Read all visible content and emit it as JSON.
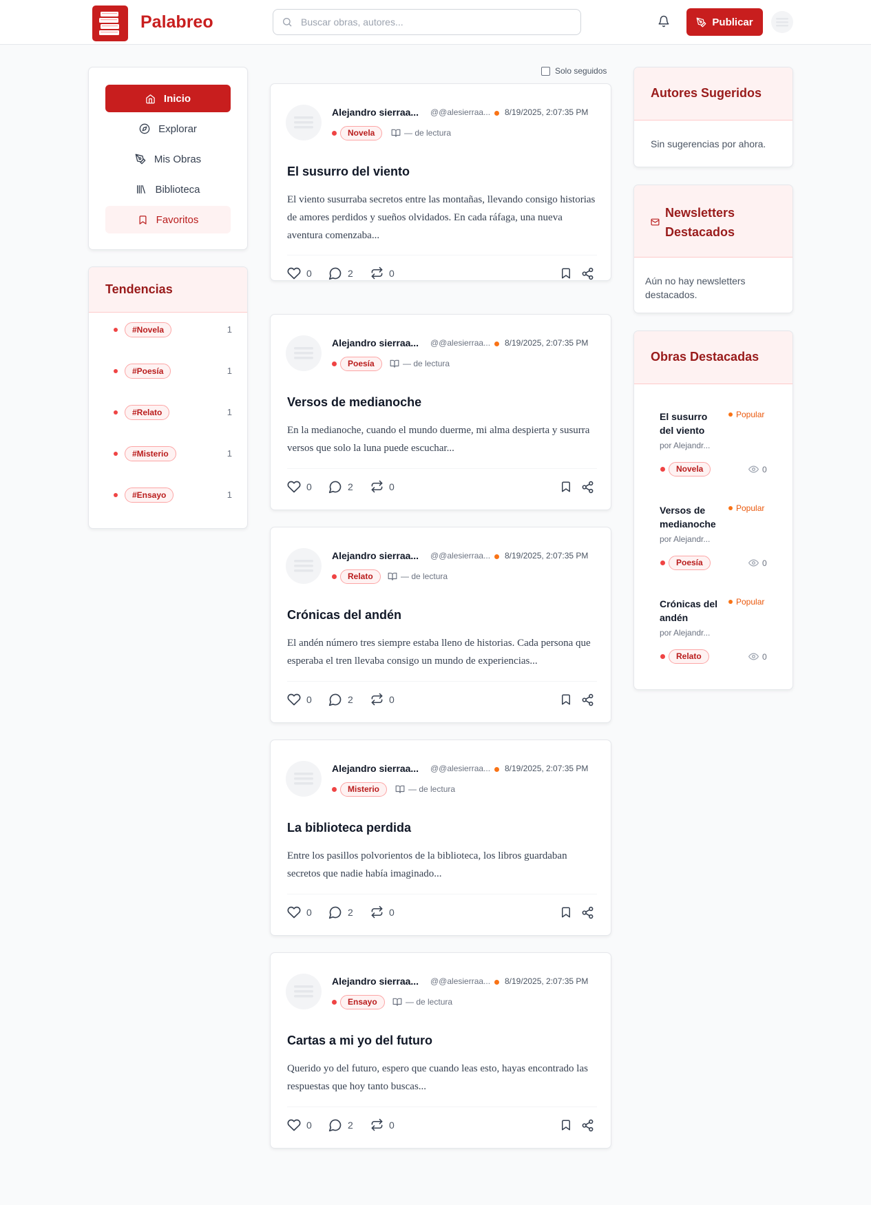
{
  "brand": {
    "name": "Palabreo",
    "color": "#c81e1e"
  },
  "header": {
    "search_placeholder": "Buscar obras, autores...",
    "publish_label": "Publicar"
  },
  "nav": {
    "items": [
      {
        "label": "Inicio",
        "icon": "home-icon",
        "state": "active"
      },
      {
        "label": "Explorar",
        "icon": "compass-icon"
      },
      {
        "label": "Mis Obras",
        "icon": "pen-icon"
      },
      {
        "label": "Biblioteca",
        "icon": "library-icon"
      },
      {
        "label": "Favoritos",
        "icon": "bookmark-icon",
        "state": "highlighted"
      }
    ]
  },
  "trends": {
    "title": "Tendencias",
    "items": [
      {
        "tag": "#Novela",
        "count": "1"
      },
      {
        "tag": "#Poesía",
        "count": "1"
      },
      {
        "tag": "#Relato",
        "count": "1"
      },
      {
        "tag": "#Misterio",
        "count": "1"
      },
      {
        "tag": "#Ensayo",
        "count": "1"
      }
    ]
  },
  "feed": {
    "filter_label": "Solo seguidos",
    "posts": [
      {
        "author": "Alejandro sierraa...",
        "handle": "@@alesierraa...",
        "date": "8/19/2025, 2:07:35 PM",
        "genre": "Novela",
        "reading": "— de lectura",
        "title": "El susurro del viento",
        "excerpt": "El viento susurraba secretos entre las montañas, llevando consigo historias de amores perdidos y sueños olvidados. En cada ráfaga, una nueva aventura comenzaba...",
        "likes": "0",
        "comments": "2",
        "reposts": "0"
      },
      {
        "author": "Alejandro sierraa...",
        "handle": "@@alesierraa...",
        "date": "8/19/2025, 2:07:35 PM",
        "genre": "Poesía",
        "reading": "— de lectura",
        "title": "Versos de medianoche",
        "excerpt": "En la medianoche, cuando el mundo duerme, mi alma despierta y susurra versos que solo la luna puede escuchar...",
        "likes": "0",
        "comments": "2",
        "reposts": "0"
      },
      {
        "author": "Alejandro sierraa...",
        "handle": "@@alesierraa...",
        "date": "8/19/2025, 2:07:35 PM",
        "genre": "Relato",
        "reading": "— de lectura",
        "title": "Crónicas del andén",
        "excerpt": "El andén número tres siempre estaba lleno de historias. Cada persona que esperaba el tren llevaba consigo un mundo de experiencias...",
        "likes": "0",
        "comments": "2",
        "reposts": "0"
      },
      {
        "author": "Alejandro sierraa...",
        "handle": "@@alesierraa...",
        "date": "8/19/2025, 2:07:35 PM",
        "genre": "Misterio",
        "reading": "— de lectura",
        "title": "La biblioteca perdida",
        "excerpt": "Entre los pasillos polvorientos de la biblioteca, los libros guardaban secretos que nadie había imaginado...",
        "likes": "0",
        "comments": "2",
        "reposts": "0"
      },
      {
        "author": "Alejandro sierraa...",
        "handle": "@@alesierraa...",
        "date": "8/19/2025, 2:07:35 PM",
        "genre": "Ensayo",
        "reading": "— de lectura",
        "title": "Cartas a mi yo del futuro",
        "excerpt": "Querido yo del futuro, espero que cuando leas esto, hayas encontrado las respuestas que hoy tanto buscas...",
        "likes": "0",
        "comments": "2",
        "reposts": "0"
      }
    ]
  },
  "suggested": {
    "title": "Autores Sugeridos",
    "empty": "Sin sugerencias por ahora."
  },
  "newsletters": {
    "title": "Newsletters Destacados",
    "empty": "Aún no hay newsletters destacados."
  },
  "featured": {
    "title": "Obras Destacadas",
    "items": [
      {
        "title": "El susurro del viento",
        "author": "por Alejandr...",
        "badge": "Popular",
        "genre": "Novela",
        "views": "0"
      },
      {
        "title": "Versos de medianoche",
        "author": "por Alejandr...",
        "badge": "Popular",
        "genre": "Poesía",
        "views": "0"
      },
      {
        "title": "Crónicas del andén",
        "author": "por Alejandr...",
        "badge": "Popular",
        "genre": "Relato",
        "views": "0"
      }
    ]
  },
  "colors": {
    "accent": "#c81e1e",
    "accent_soft": "#fef2f2",
    "popular": "#f97316"
  }
}
